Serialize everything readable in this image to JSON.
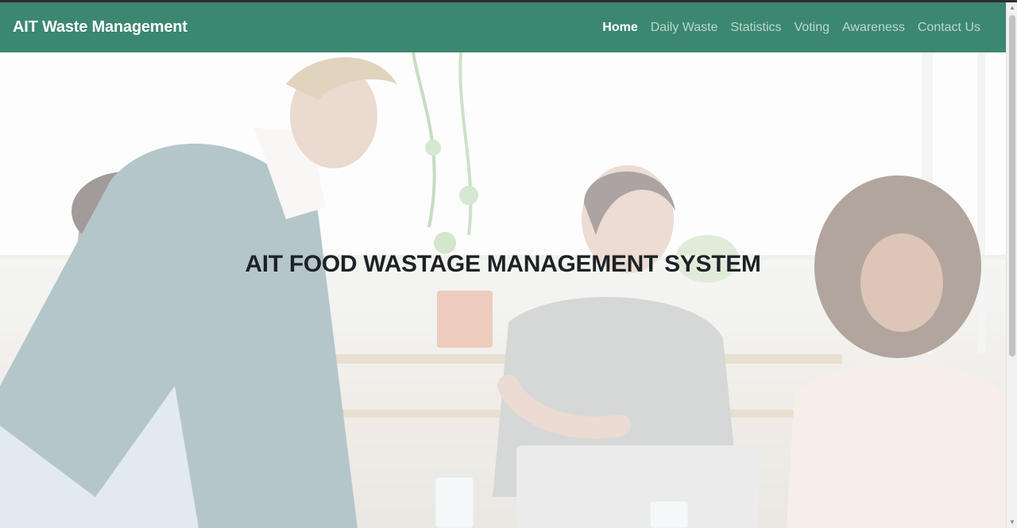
{
  "brand": {
    "title": "AIT Waste Management"
  },
  "nav": {
    "items": [
      {
        "label": "Home",
        "active": true
      },
      {
        "label": "Daily Waste",
        "active": false
      },
      {
        "label": "Statistics",
        "active": false
      },
      {
        "label": "Voting",
        "active": false
      },
      {
        "label": "Awareness",
        "active": false
      },
      {
        "label": "Contact Us",
        "active": false
      }
    ]
  },
  "hero": {
    "title": "AIT FOOD WASTAGE MANAGEMENT SYSTEM",
    "image": "team-meeting-photo"
  },
  "colors": {
    "navbar": "#3b8770",
    "nav_active": "#ffffff",
    "nav_inactive": "#d3e5de",
    "hero_title": "#1d2226"
  },
  "icons": {
    "scroll_up": "arrow-up-icon",
    "scroll_down": "arrow-down-icon"
  }
}
